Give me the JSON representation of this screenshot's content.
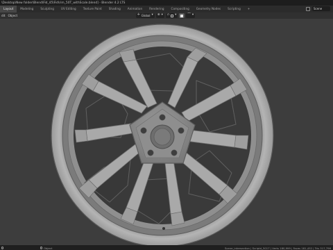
{
  "window": {
    "title": "\\Desktop\\New folder\\Blend\\Fid_45\\Fid\\rim_50T_withScale.blend] - Blender 4.2 LTS"
  },
  "workspaces": {
    "tabs": [
      "Layout",
      "Modeling",
      "Sculpting",
      "UV Editing",
      "Texture Paint",
      "Shading",
      "Animation",
      "Rendering",
      "Compositing",
      "Geometry Nodes",
      "Scripting",
      "+"
    ],
    "active_index": 0,
    "scene_label": "Scene"
  },
  "header": {
    "menu": [
      "dit",
      "Object"
    ],
    "transform_orientation": "Global"
  },
  "status": {
    "left": [
      "Object"
    ],
    "right": "Scene_intersection | Scriptd_5017 | Verts 180,999 | Faces 181,452 | Tris 317,796"
  },
  "colors": {
    "viewport_bg": "#3d3d3d",
    "wheel": "#a8a8a8",
    "wheel_dark": "#6c6c6c",
    "wheel_light": "#cacaca"
  }
}
